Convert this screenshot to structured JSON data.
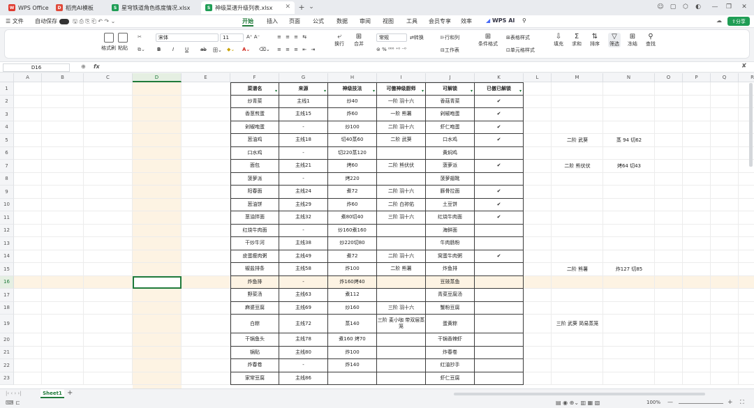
{
  "tabs": [
    {
      "label": "WPS Office",
      "icon": "wps-icon",
      "color": "#e03a2f",
      "active": false
    },
    {
      "label": "稻壳AI模板",
      "icon": "daoke-icon",
      "color": "#e04a3a",
      "active": false
    },
    {
      "label": "星穹铁道角色练度情况.xlsx",
      "icon": "sheet-file-icon",
      "color": "#1f9d55",
      "active": false
    },
    {
      "label": "神级菜谱升级列表.xlsx",
      "icon": "sheet-file-icon",
      "color": "#1f9d55",
      "active": true
    }
  ],
  "menu": {
    "file": "文件",
    "autosave": "自动保存",
    "items": [
      "开始",
      "插入",
      "页面",
      "公式",
      "数据",
      "审阅",
      "视图",
      "工具",
      "会员专享",
      "效率"
    ],
    "active": "开始",
    "wps_ai": "WPS AI",
    "share": "分享"
  },
  "ribbon": {
    "format_painter": "格式刷",
    "paste": "粘贴",
    "font": "宋体",
    "font_size": "11",
    "bold": "B",
    "italic": "I",
    "underline": "U",
    "strike": "ab",
    "wrap": "换行",
    "merge": "合并",
    "number_format": "常规",
    "convert": "转换",
    "row_col": "行和列",
    "worksheet": "工作表",
    "cond_format": "条件格式",
    "table_style": "表格样式",
    "cell_style": "单元格样式",
    "fill": "填充",
    "sum": "求和",
    "sort": "排序",
    "filter": "筛选",
    "freeze": "冻结",
    "find": "查找"
  },
  "formula_bar": {
    "name_box": "D16",
    "fx": "fx",
    "value": ""
  },
  "columns": [
    "A",
    "B",
    "C",
    "D",
    "E",
    "F",
    "G",
    "H",
    "I",
    "J",
    "K",
    "L",
    "M",
    "N",
    "O",
    "P",
    "Q",
    "R"
  ],
  "selected_column": "D",
  "selected_row": 16,
  "row_numbers": [
    "1",
    "2",
    "3",
    "4",
    "5",
    "6",
    "7",
    "8",
    "9",
    "10",
    "11",
    "12",
    "13",
    "14",
    "15",
    "16",
    "17",
    "18",
    "19",
    "20",
    "21",
    "22",
    "23"
  ],
  "table": {
    "headers": [
      "菜谱名",
      "来源",
      "神级技法",
      "可傲神级厨师",
      "可解锁",
      "已傲已解锁"
    ],
    "rows": [
      [
        "炒青菜",
        "主线1",
        "炒40",
        "一阶 羽十六",
        "香菇青菜",
        "✔"
      ],
      [
        "香葱煎蛋",
        "主线15",
        "炸60",
        "一阶 熊薯",
        "剁椒咆蛋",
        "✔"
      ],
      [
        "剁椒咆蛋",
        "-",
        "炒100",
        "二阶 羽十六",
        "虾仁咆蛋",
        "✔"
      ],
      [
        "葱油鸡",
        "主线18",
        "切40蒸60",
        "二阶 武葵",
        "口水鸡",
        "✔"
      ],
      [
        "口水鸡",
        "-",
        "切220蒸120",
        "",
        "黄焖鸡",
        ""
      ],
      [
        "面包",
        "主线21",
        "烤60",
        "二阶 熊伏伏",
        "菠萝派",
        "✔"
      ],
      [
        "菠萝派",
        "-",
        "烤220",
        "",
        "菠萝翅靴",
        ""
      ],
      [
        "阳春面",
        "主线24",
        "煮72",
        "二阶 羽十六",
        "豚骨拉面",
        "✔"
      ],
      [
        "葱油饼",
        "主线29",
        "炸60",
        "二阶 白祢佑",
        "土豆饼",
        "✔"
      ],
      [
        "葱油拌面",
        "主线32",
        "煮80切40",
        "三阶 羽十六",
        "红烧牛肉面",
        "✔"
      ],
      [
        "红烧牛肉面",
        "-",
        "炒160煮160",
        "",
        "海鲜面",
        ""
      ],
      [
        "干炒牛河",
        "主线38",
        "炒220切80",
        "",
        "牛肉肠粉",
        ""
      ],
      [
        "皮蛋瘦肉粥",
        "主线49",
        "煮72",
        "二阶 羽十六",
        "窝蛋牛肉粥",
        "✔"
      ],
      [
        "椒盐排条",
        "主线58",
        "炸100",
        "二阶 熊薯",
        "炸鱼排",
        ""
      ],
      [
        "炸鱼排",
        "-",
        "炸160烤40",
        "",
        "豆豉蒸鱼",
        ""
      ],
      [
        "野菜汤",
        "主线63",
        "煮112",
        "",
        "青菜豆腐汤",
        ""
      ],
      [
        "麻婆豆腐",
        "主线69",
        "炒160",
        "三阶 羽十六",
        "蟹粉豆腐",
        ""
      ],
      [
        "白粽",
        "主线72",
        "蒸140",
        "三阶 麦小咖 带双层蒸笼",
        "蛋黄粽",
        ""
      ],
      [
        "干锅鱼头",
        "主线78",
        "煮160 烤70",
        "",
        "干锅香辣虾",
        ""
      ],
      [
        "锅贴",
        "主线80",
        "炸100",
        "",
        "炸春卷",
        ""
      ],
      [
        "炸春卷",
        "-",
        "炸140",
        "",
        "红油抄手",
        ""
      ],
      [
        "家常豆腐",
        "主线86",
        "",
        "",
        "虾仁豆腐",
        ""
      ]
    ]
  },
  "notes": [
    {
      "row": 5,
      "m": "二阶 武葵",
      "n": "蒸 94 切62"
    },
    {
      "row": 7,
      "m": "二阶 熊伏伏",
      "n": "烤64 切43"
    },
    {
      "row": 15,
      "m": "二阶 熊薯",
      "n": "炸127 切85"
    },
    {
      "row": 19,
      "m": "三阶 武葵 简易蒸笼",
      "n": ""
    }
  ],
  "sheet_tabs": {
    "active": "Sheet1",
    "add": "+"
  },
  "status": {
    "zoom": "100%"
  },
  "colors": {
    "accent": "#1f7a3a",
    "selection": "#fdf3e3"
  }
}
